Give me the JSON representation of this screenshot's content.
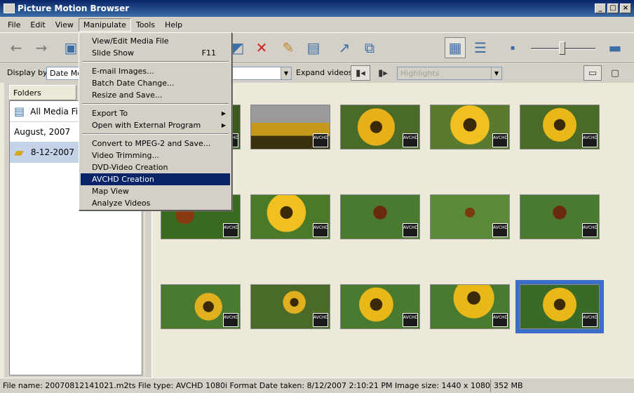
{
  "window": {
    "title": "Picture Motion Browser"
  },
  "menubar": [
    "File",
    "Edit",
    "View",
    "Manipulate",
    "Tools",
    "Help"
  ],
  "manipulate_menu": {
    "items": [
      {
        "label": "View/Edit Media File",
        "shortcut": ""
      },
      {
        "label": "Slide Show",
        "shortcut": "F11"
      },
      {
        "label": "E-mail Images..."
      },
      {
        "label": "Batch Date Change..."
      },
      {
        "label": "Resize and Save..."
      },
      {
        "label": "Export To"
      },
      {
        "label": "Open with External Program"
      },
      {
        "label": "Convert to MPEG-2 and Save..."
      },
      {
        "label": "Video Trimming..."
      },
      {
        "label": "DVD-Video Creation"
      },
      {
        "label": "AVCHD Creation"
      },
      {
        "label": "Map View"
      },
      {
        "label": "Analyze Videos"
      }
    ],
    "highlighted": "AVCHD Creation"
  },
  "options": {
    "display_by_label": "Display by:",
    "display_by_value": "Date Mo",
    "expand_videos_label": "Expand videos:",
    "highlights_value": "Highlights"
  },
  "folders": {
    "tab": "Folders",
    "all_media": "All Media Files",
    "month": "August, 2007",
    "date": "8-12-2007"
  },
  "thumbnails": {
    "badge": "AVCHD",
    "selected_index": 14
  },
  "status": {
    "info": "File name: 20070812141021.m2ts  File type: AVCHD 1080i Format  Date taken: 8/12/2007 2:10:21 PM  Image size: 1440 x 1080",
    "size": "352 MB"
  },
  "colors": {
    "title_bar": "#0a246a",
    "menu_highlight": "#0a246a",
    "selection": "#3a6ec9",
    "chrome": "#d4d0c8"
  }
}
